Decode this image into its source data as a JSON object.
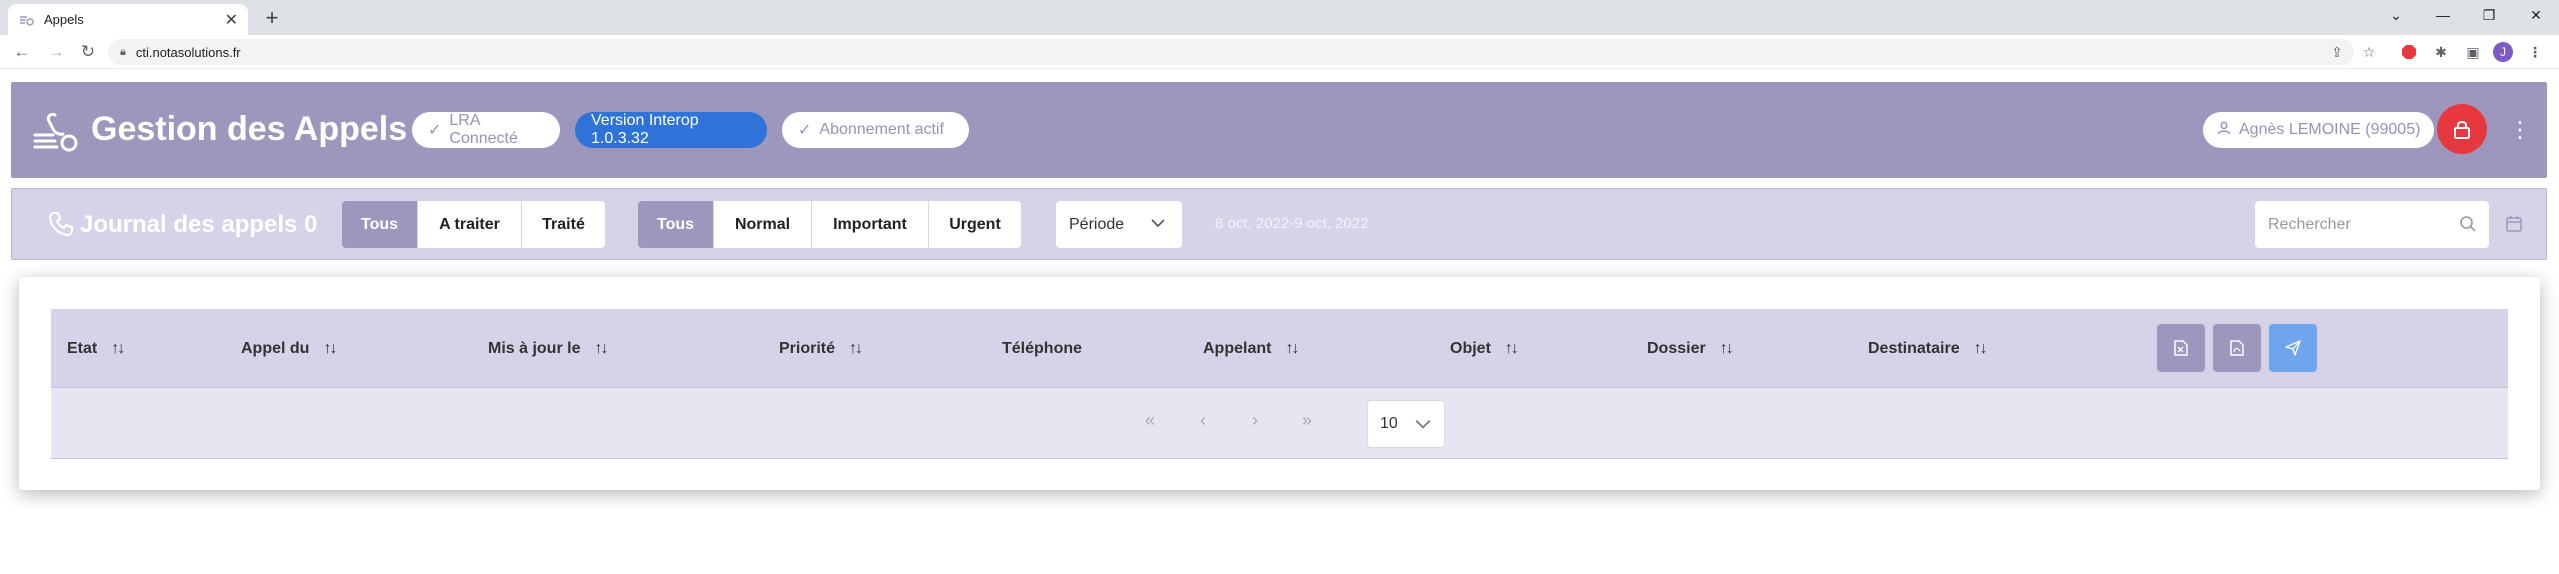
{
  "browser": {
    "tab_title": "Appels",
    "tab_close": "✕",
    "new_tab": "+",
    "url": "cti.notasolutions.fr",
    "window_controls": [
      "⌄",
      "—",
      "❐",
      "✕"
    ],
    "profile_initial": "J"
  },
  "header": {
    "title": "Gestion des Appels",
    "badges": {
      "lra": "LRA Connecté",
      "version": "Version Interop 1.0.3.32",
      "subscription": "Abonnement actif"
    },
    "user": "Agnès LEMOINE (99005)",
    "colors": {
      "header_bg": "#9e97bd",
      "version_badge": "#2f73d9",
      "lock_button": "#e8383f"
    }
  },
  "journal": {
    "title": "Journal des appels 0",
    "status_filter": [
      "Tous",
      "A traiter",
      "Traité"
    ],
    "priority_filter": [
      "Tous",
      "Normal",
      "Important",
      "Urgent"
    ],
    "period_label": "Période",
    "date_range": "8 oct. 2022-9 oct. 2022",
    "search_placeholder": "Rechercher"
  },
  "table": {
    "columns": [
      "Etat",
      "Appel du",
      "Mis à jour le",
      "Priorité",
      "Téléphone",
      "Appelant",
      "Objet",
      "Dossier",
      "Destinataire"
    ],
    "sort_glyph": "↑↓",
    "pagination": [
      "«",
      "‹",
      "›",
      "»"
    ],
    "rows_per_page": "10"
  }
}
